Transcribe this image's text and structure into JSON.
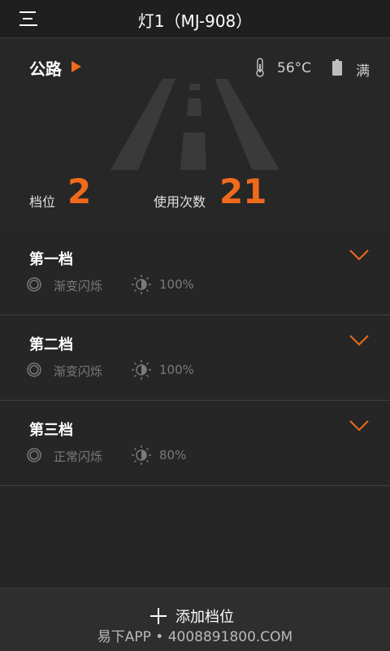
{
  "header": {
    "title": "灯1（MJ-908）",
    "menu_icon": "menu-icon"
  },
  "status": {
    "mode": "公路",
    "temperature": "56°C",
    "battery": "满",
    "gear_label": "档位",
    "gear_value": "2",
    "uses_label": "使用次数",
    "uses_value": "21"
  },
  "gears": [
    {
      "name": "第一档",
      "flash_mode": "渐变闪烁",
      "brightness": "100%"
    },
    {
      "name": "第二档",
      "flash_mode": "渐变闪烁",
      "brightness": "100%"
    },
    {
      "name": "第三档",
      "flash_mode": "正常闪烁",
      "brightness": "80%"
    }
  ],
  "footer": {
    "add_label": "添加档位",
    "watermark": "易下APP • 4008891800.COM"
  },
  "colors": {
    "accent": "#f06a1c",
    "background": "#262626",
    "header_bg": "#1f1f1f",
    "muted_text": "#7a7a7a"
  }
}
